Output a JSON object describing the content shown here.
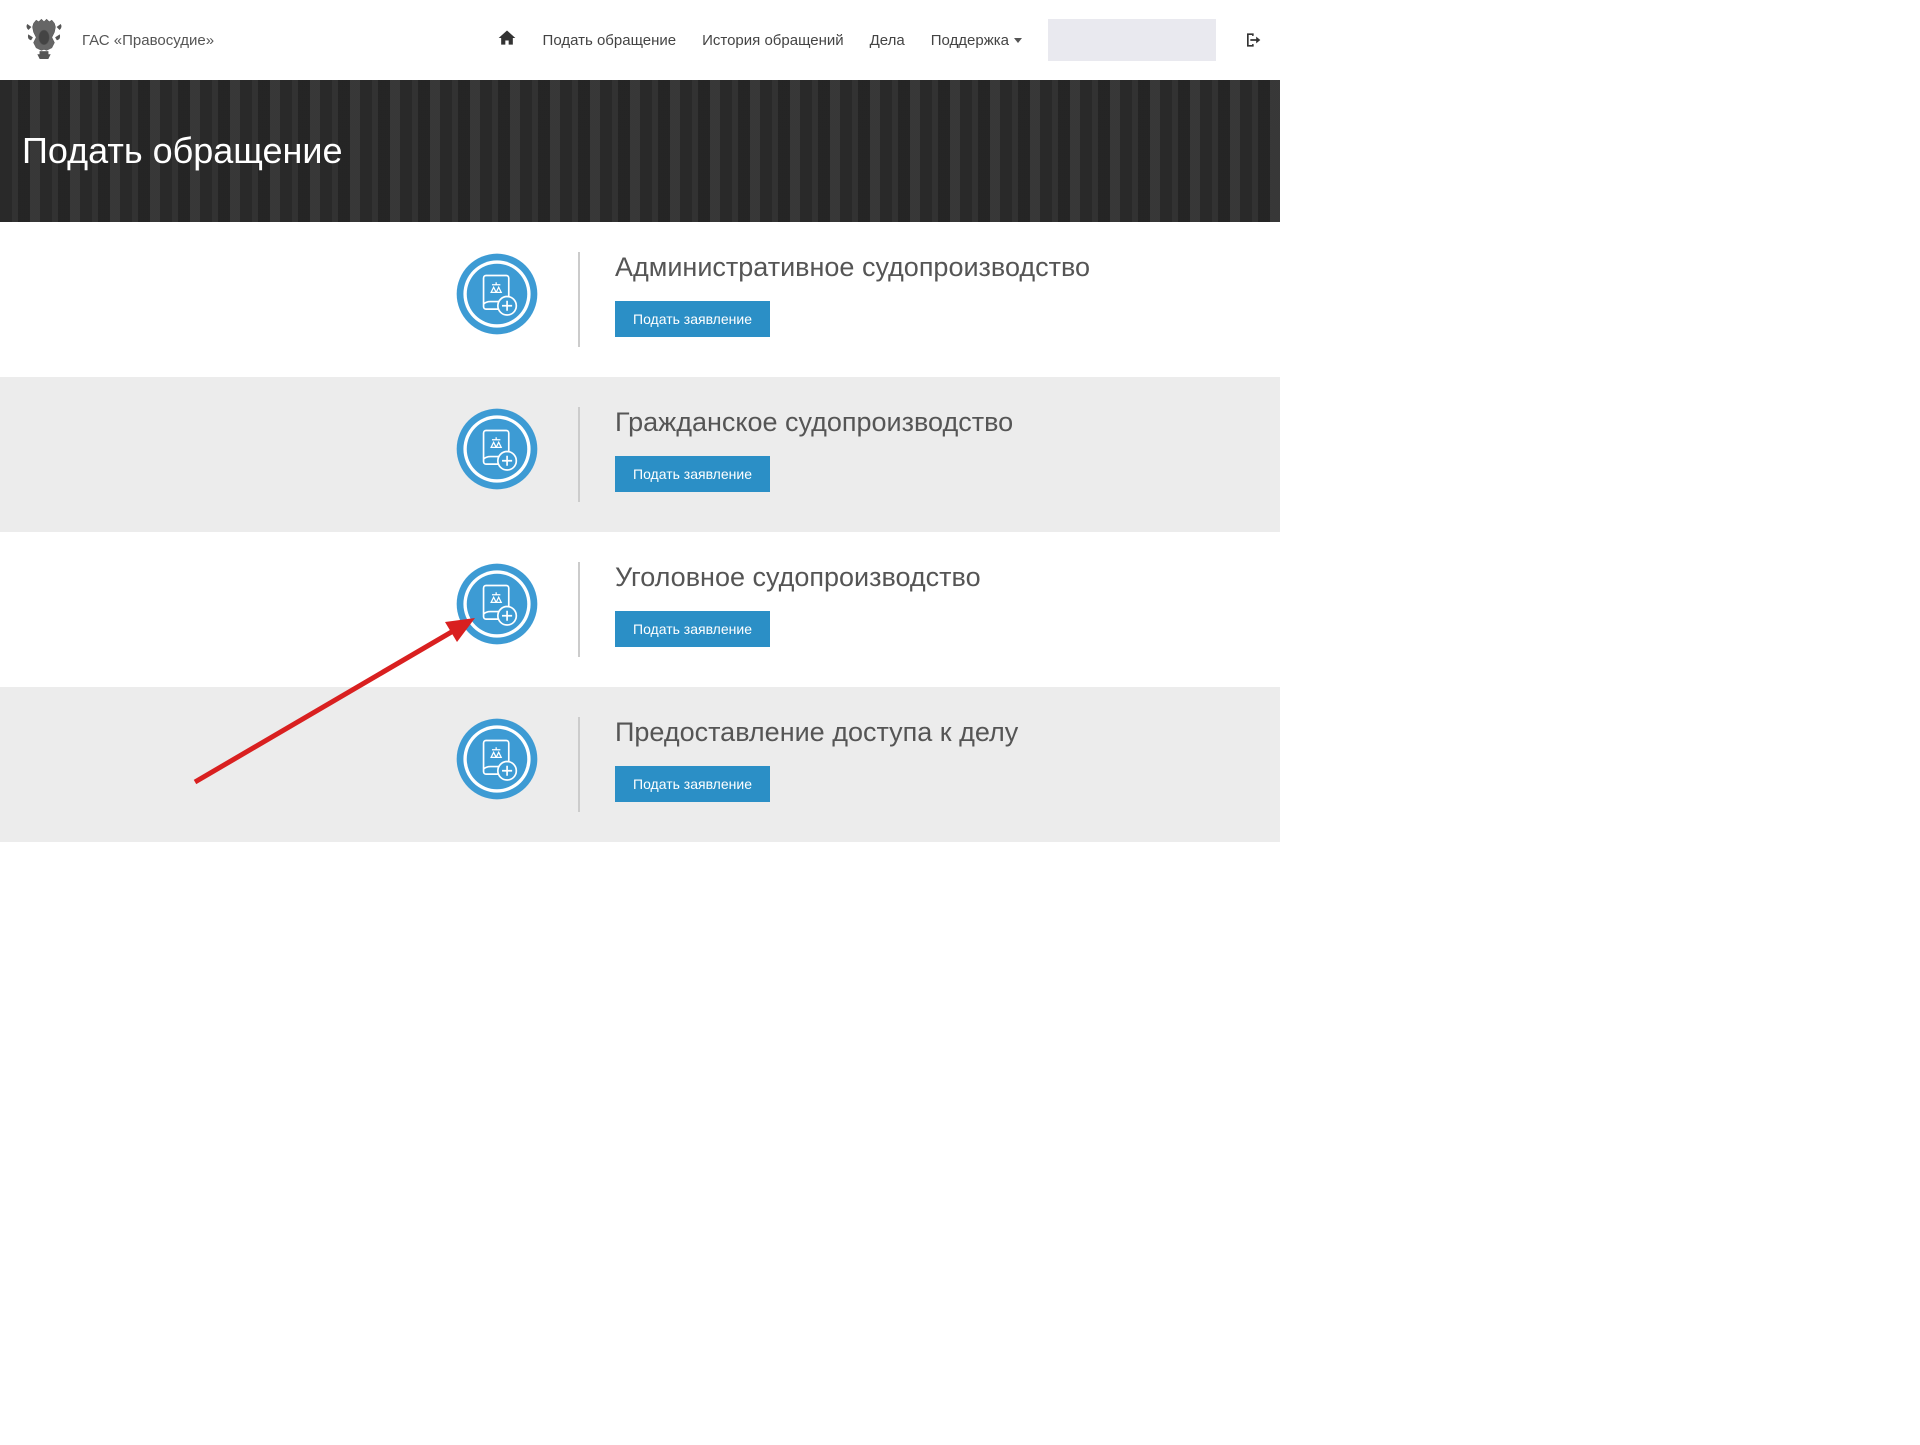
{
  "site": {
    "title": "ГАС «Правосудие»"
  },
  "nav": {
    "submit": "Подать обращение",
    "history": "История обращений",
    "cases": "Дела",
    "support": "Поддержка"
  },
  "hero": {
    "title": "Подать обращение"
  },
  "categories": [
    {
      "title": "Административное судопроизводство",
      "button": "Подать заявление"
    },
    {
      "title": "Гражданское судопроизводство",
      "button": "Подать заявление"
    },
    {
      "title": "Уголовное судопроизводство",
      "button": "Подать заявление"
    },
    {
      "title": "Предоставление доступа к делу",
      "button": "Подать заявление"
    }
  ]
}
